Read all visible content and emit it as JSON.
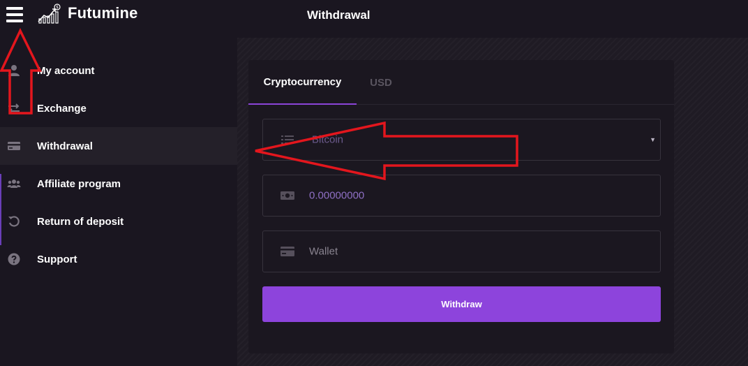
{
  "header": {
    "brand": "Futumine",
    "title": "Withdrawal"
  },
  "sidebar": {
    "items": [
      {
        "label": "My account",
        "icon": "user-icon"
      },
      {
        "label": "Exchange",
        "icon": "exchange-arrows-icon"
      },
      {
        "label": "Withdrawal",
        "icon": "card-icon",
        "active": true
      },
      {
        "label": "Affiliate program",
        "icon": "users-group-icon"
      },
      {
        "label": "Return of deposit",
        "icon": "undo-icon"
      },
      {
        "label": "Support",
        "icon": "question-circle-icon"
      }
    ]
  },
  "tabs": [
    {
      "label": "Cryptocurrency",
      "active": true
    },
    {
      "label": "USD",
      "active": false
    }
  ],
  "form": {
    "currency_value": "Bitcoin",
    "amount_value": "0.00000000",
    "wallet_placeholder": "Wallet",
    "submit_label": "Withdraw"
  },
  "colors": {
    "accent": "#8d44dc",
    "background": "#1a1620",
    "annotation_arrow": "#e3161d"
  }
}
